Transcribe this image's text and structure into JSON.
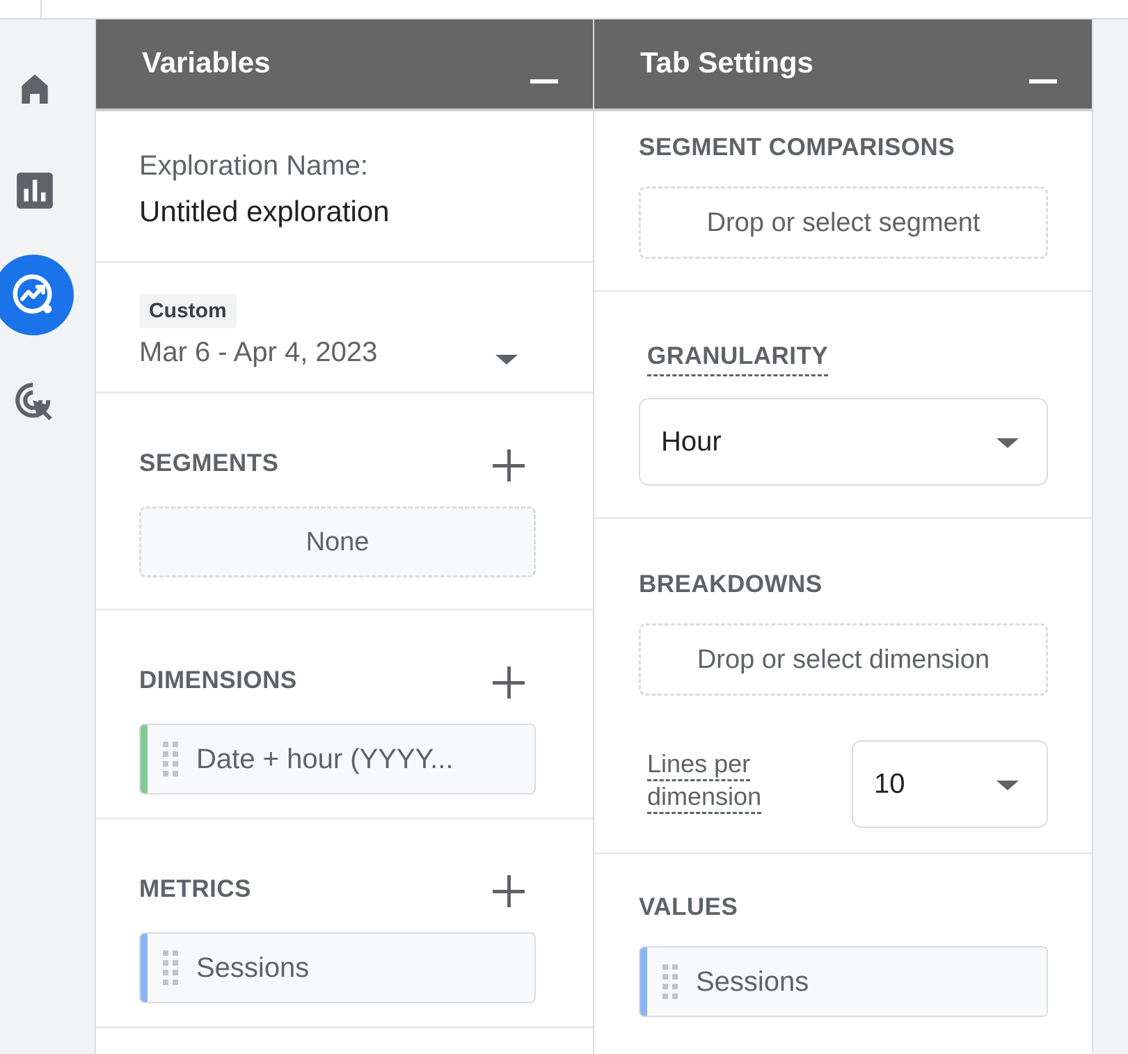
{
  "rail": {
    "items": [
      {
        "name": "home-icon",
        "active": false
      },
      {
        "name": "reports-icon",
        "active": false
      },
      {
        "name": "explore-icon",
        "active": true
      },
      {
        "name": "advertising-icon",
        "active": false
      }
    ],
    "active_color": "#1a73e8"
  },
  "variables": {
    "title": "Variables",
    "exploration_label": "Exploration Name:",
    "exploration_name": "Untitled exploration",
    "date_badge": "Custom",
    "date_range": "Mar 6 - Apr 4, 2023",
    "segments": {
      "label": "SEGMENTS",
      "empty": "None"
    },
    "dimensions": {
      "label": "DIMENSIONS",
      "items": [
        "Date + hour (YYYY..."
      ],
      "accent": "#81c995"
    },
    "metrics": {
      "label": "METRICS",
      "items": [
        "Sessions"
      ],
      "accent": "#8ab4f8"
    }
  },
  "tab_settings": {
    "title": "Tab Settings",
    "segment_comparisons": {
      "label": "SEGMENT COMPARISONS",
      "placeholder": "Drop or select segment"
    },
    "granularity": {
      "label": "GRANULARITY",
      "value": "Hour"
    },
    "breakdowns": {
      "label": "BREAKDOWNS",
      "placeholder": "Drop or select dimension"
    },
    "lines_per_dimension": {
      "label_line1": "Lines per",
      "label_line2": "dimension",
      "value": "10"
    },
    "values": {
      "label": "VALUES",
      "items": [
        "Sessions"
      ],
      "accent": "#8ab4f8"
    }
  }
}
